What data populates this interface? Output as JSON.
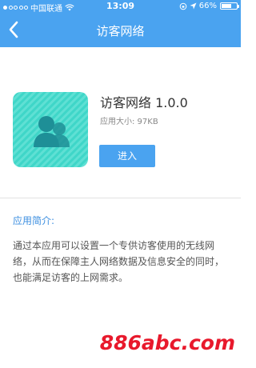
{
  "status_bar": {
    "carrier": "中国联通",
    "time": "13:09",
    "battery": "66%",
    "battery_level": 0.66
  },
  "nav": {
    "title": "访客网络",
    "back_icon": "chevron-left-icon"
  },
  "app": {
    "name": "访客网络 1.0.0",
    "size": "应用大小: 97KB",
    "enter_label": "进入",
    "icon": "guest-users-icon",
    "icon_color": "#39d3c5",
    "icon_figure_color": "#1e8f97"
  },
  "description": {
    "title": "应用简介:",
    "text": "通过本应用可以设置一个专供访客使用的无线网络，从而在保障主人网络数据及信息安全的同时，也能满足访客的上网需求。"
  },
  "watermark": "886abc.com",
  "colors": {
    "header": "#4aa3f0",
    "button": "#4aa3f0",
    "accent_text": "#3d8fe0",
    "watermark": "#e8192c"
  }
}
